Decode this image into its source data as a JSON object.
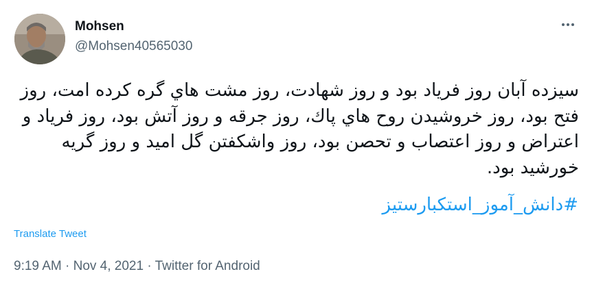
{
  "author": {
    "name": "Mohsen",
    "handle": "@Mohsen40565030"
  },
  "tweet": {
    "text": "سيزده آبان روز فرياد بود و روز شهادت، روز مشت هاي گره كرده امت، روز فتح بود، روز خروشيدن روح هاي پاك، روز جرقه و روز آتش بود، روز فرياد و اعتراض و روز اعتصاب و تحصن بود، روز واشكفتن گل اميد و روز گريه خورشيد بود.",
    "hashtag": "#دانش_آموز_استكبارستيز",
    "translate_label": "Translate Tweet"
  },
  "meta": {
    "time": "9:19 AM",
    "separator": " · ",
    "date": "Nov 4, 2021",
    "source": "Twitter for Android"
  },
  "colors": {
    "text": "#0f1419",
    "secondary": "#536471",
    "link": "#1d9bf0"
  },
  "icons": {
    "more": "more-horizontal-icon"
  }
}
